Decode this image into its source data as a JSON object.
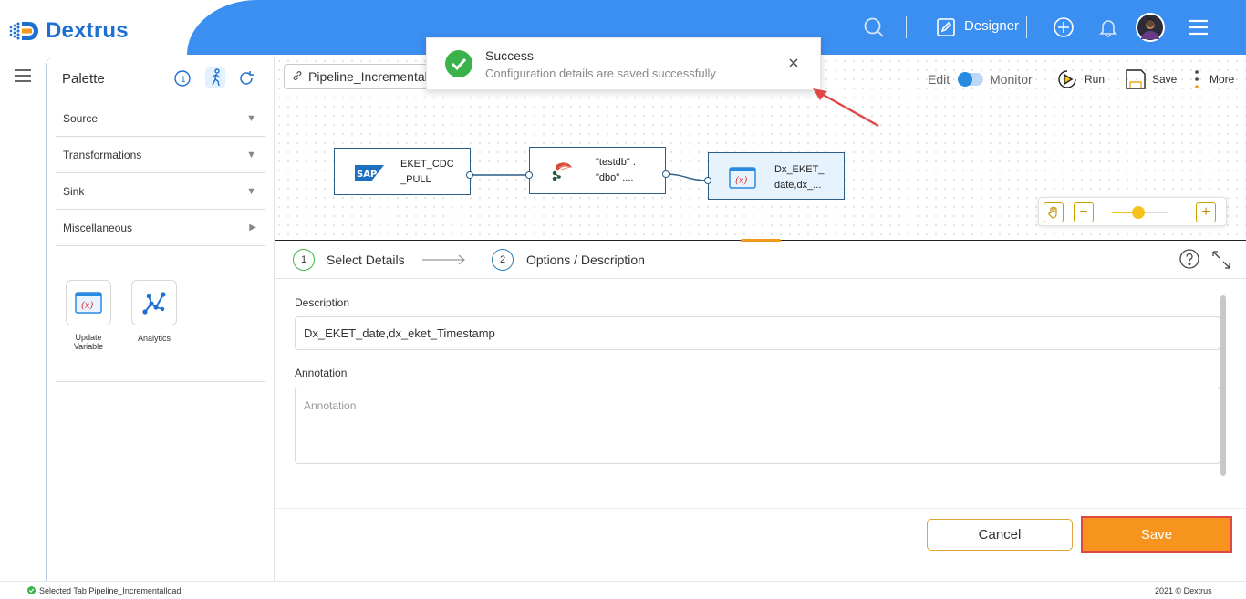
{
  "header": {
    "logo_text": "Dextrus",
    "designer_label": "Designer"
  },
  "palette": {
    "title": "Palette",
    "sections": [
      {
        "label": "Source",
        "arrow": "down"
      },
      {
        "label": "Transformations",
        "arrow": "down"
      },
      {
        "label": "Sink",
        "arrow": "down"
      },
      {
        "label": "Miscellaneous",
        "arrow": "right"
      }
    ],
    "tools": [
      {
        "label": "Update Variable",
        "icon": "variable-icon"
      },
      {
        "label": "Analytics",
        "icon": "analytics-icon"
      }
    ]
  },
  "pipeline": {
    "tab_label": "Pipeline_Incrementalload",
    "nodes": [
      {
        "line1": "EKET_CDC",
        "line2": "_PULL",
        "icon": "sap-icon"
      },
      {
        "line1": "\"testdb\" .",
        "line2": "\"dbo\" ....",
        "icon": "database-icon"
      },
      {
        "line1": "Dx_EKET_",
        "line2": "date,dx_...",
        "icon": "variable-icon"
      }
    ]
  },
  "toast": {
    "title": "Success",
    "message": "Configuration details are saved successfully"
  },
  "toolbar": {
    "edit_label": "Edit",
    "monitor_label": "Monitor",
    "run_label": "Run",
    "save_label": "Save",
    "more_label": "More"
  },
  "zoom": {
    "level": 0.45
  },
  "details": {
    "steps": [
      {
        "number": "1",
        "label": "Select Details"
      },
      {
        "number": "2",
        "label": "Options / Description"
      }
    ],
    "description_label": "Description",
    "description_value": "Dx_EKET_date,dx_eket_Timestamp",
    "annotation_label": "Annotation",
    "annotation_placeholder": "Annotation",
    "cancel_label": "Cancel",
    "save_label": "Save"
  },
  "statusbar": {
    "selected_tab": "Selected Tab Pipeline_Incrementalload",
    "copyright": "2021 © Dextrus"
  },
  "colors": {
    "header_blue": "#3b8ff0",
    "accent_orange": "#f7941d",
    "success_green": "#3ab44a",
    "brand_blue": "#1d6fd1"
  }
}
